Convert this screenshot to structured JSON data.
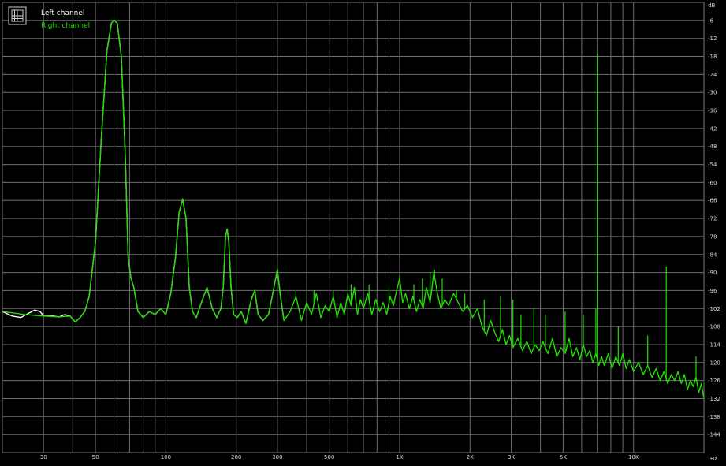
{
  "chart_data": {
    "type": "line",
    "x_scale": "log",
    "xlim": [
      20,
      20000
    ],
    "ylim": [
      -150,
      0
    ],
    "x_unit": "Hz",
    "y_unit": "dB",
    "grid": true,
    "legend_position": "top-left",
    "x_ticks": [
      {
        "value": 30,
        "label": "30"
      },
      {
        "value": 50,
        "label": "50"
      },
      {
        "value": 100,
        "label": "100"
      },
      {
        "value": 200,
        "label": "200"
      },
      {
        "value": 300,
        "label": "300"
      },
      {
        "value": 500,
        "label": "500"
      },
      {
        "value": 1000,
        "label": "1K"
      },
      {
        "value": 2000,
        "label": "2K"
      },
      {
        "value": 3000,
        "label": "3K"
      },
      {
        "value": 5000,
        "label": "5K"
      },
      {
        "value": 10000,
        "label": "10K"
      }
    ],
    "y_ticks": [
      {
        "value": -6,
        "label": "-6"
      },
      {
        "value": -12,
        "label": "-12"
      },
      {
        "value": -18,
        "label": "-18"
      },
      {
        "value": -24,
        "label": "-24"
      },
      {
        "value": -30,
        "label": "-30"
      },
      {
        "value": -36,
        "label": "-36"
      },
      {
        "value": -42,
        "label": "-42"
      },
      {
        "value": -48,
        "label": "-48"
      },
      {
        "value": -54,
        "label": "-54"
      },
      {
        "value": -60,
        "label": "-60"
      },
      {
        "value": -66,
        "label": "-66"
      },
      {
        "value": -72,
        "label": "-72"
      },
      {
        "value": -78,
        "label": "-78"
      },
      {
        "value": -84,
        "label": "-84"
      },
      {
        "value": -90,
        "label": "-90"
      },
      {
        "value": -96,
        "label": "-96"
      },
      {
        "value": -102,
        "label": "-102"
      },
      {
        "value": -108,
        "label": "-108"
      },
      {
        "value": -114,
        "label": "-114"
      },
      {
        "value": -120,
        "label": "-120"
      },
      {
        "value": -126,
        "label": "-126"
      },
      {
        "value": -132,
        "label": "-132"
      },
      {
        "value": -138,
        "label": "-138"
      },
      {
        "value": -144,
        "label": "-144"
      }
    ],
    "series": [
      {
        "name": "Left channel",
        "color": "#ffffff",
        "points": [
          [
            20,
            -103
          ],
          [
            22,
            -104.5
          ],
          [
            24,
            -105
          ],
          [
            26,
            -103.5
          ],
          [
            27.5,
            -102.5
          ],
          [
            29,
            -103
          ],
          [
            30,
            -104.5
          ],
          [
            33,
            -104.5
          ],
          [
            35,
            -104.8
          ],
          [
            37,
            -104
          ],
          [
            39,
            -104.5
          ],
          [
            41,
            -106.5
          ],
          [
            43,
            -105
          ],
          [
            45,
            -103
          ],
          [
            47,
            -98
          ],
          [
            50,
            -80
          ],
          [
            53,
            -45
          ],
          [
            56,
            -16
          ],
          [
            58.5,
            -7
          ],
          [
            60,
            -5.8
          ],
          [
            62,
            -7
          ],
          [
            64.5,
            -18
          ],
          [
            67,
            -50
          ],
          [
            69,
            -85
          ],
          [
            71,
            -92
          ],
          [
            73,
            -95
          ],
          [
            76,
            -103
          ],
          [
            80,
            -105
          ],
          [
            85,
            -103
          ],
          [
            90,
            -104
          ],
          [
            95,
            -102
          ],
          [
            100,
            -104
          ],
          [
            105,
            -97
          ],
          [
            110,
            -85
          ],
          [
            114,
            -70
          ],
          [
            118,
            -65.5
          ],
          [
            122,
            -72
          ],
          [
            126,
            -95
          ],
          [
            130,
            -103
          ],
          [
            135,
            -105
          ],
          [
            142,
            -100
          ],
          [
            150,
            -95
          ],
          [
            158,
            -102
          ],
          [
            165,
            -105
          ],
          [
            172,
            -102
          ],
          [
            176,
            -95
          ],
          [
            180,
            -78
          ],
          [
            183,
            -75.5
          ],
          [
            186,
            -80
          ],
          [
            190,
            -95
          ],
          [
            195,
            -104
          ],
          [
            202,
            -105
          ],
          [
            210,
            -103
          ],
          [
            220,
            -107
          ],
          [
            232,
            -99
          ],
          [
            240,
            -96
          ],
          [
            248,
            -104
          ],
          [
            260,
            -106
          ],
          [
            275,
            -104
          ],
          [
            290,
            -95
          ],
          [
            300,
            -89
          ],
          [
            308,
            -97
          ],
          [
            320,
            -106
          ]
        ]
      },
      {
        "name": "Right channel",
        "color": "#22dd00",
        "points": [
          [
            20,
            -103
          ],
          [
            25,
            -104
          ],
          [
            30,
            -104.5
          ],
          [
            35,
            -104.8
          ],
          [
            39,
            -104.5
          ],
          [
            41,
            -106.5
          ],
          [
            43,
            -105
          ],
          [
            45,
            -103
          ],
          [
            47,
            -98
          ],
          [
            50,
            -80
          ],
          [
            53,
            -45
          ],
          [
            56,
            -16
          ],
          [
            58.5,
            -7
          ],
          [
            60,
            -5.8
          ],
          [
            62,
            -7
          ],
          [
            64.5,
            -18
          ],
          [
            67,
            -50
          ],
          [
            69,
            -85
          ],
          [
            71,
            -92
          ],
          [
            73,
            -95
          ],
          [
            76,
            -103
          ],
          [
            80,
            -105
          ],
          [
            85,
            -103
          ],
          [
            90,
            -104
          ],
          [
            95,
            -102
          ],
          [
            100,
            -104
          ],
          [
            105,
            -97
          ],
          [
            110,
            -85
          ],
          [
            114,
            -70
          ],
          [
            118,
            -65.5
          ],
          [
            122,
            -72
          ],
          [
            126,
            -95
          ],
          [
            130,
            -103
          ],
          [
            135,
            -105
          ],
          [
            142,
            -100
          ],
          [
            150,
            -95
          ],
          [
            158,
            -102
          ],
          [
            165,
            -105
          ],
          [
            172,
            -102
          ],
          [
            176,
            -95
          ],
          [
            180,
            -78
          ],
          [
            183,
            -75.5
          ],
          [
            186,
            -80
          ],
          [
            190,
            -95
          ],
          [
            195,
            -104
          ],
          [
            202,
            -105
          ],
          [
            210,
            -103
          ],
          [
            220,
            -107
          ],
          [
            232,
            -99
          ],
          [
            240,
            -96
          ],
          [
            248,
            -104
          ],
          [
            260,
            -106
          ],
          [
            275,
            -104
          ],
          [
            290,
            -95
          ],
          [
            300,
            -89
          ],
          [
            308,
            -97
          ],
          [
            320,
            -106
          ],
          [
            340,
            -103
          ],
          [
            360,
            -98
          ],
          [
            380,
            -106
          ],
          [
            400,
            -100
          ],
          [
            420,
            -104
          ],
          [
            440,
            -97
          ],
          [
            460,
            -105
          ],
          [
            480,
            -101
          ],
          [
            500,
            -103
          ],
          [
            520,
            -98
          ],
          [
            540,
            -105
          ],
          [
            560,
            -100
          ],
          [
            580,
            -104
          ],
          [
            600,
            -97
          ],
          [
            620,
            -101
          ],
          [
            640,
            -95
          ],
          [
            660,
            -104
          ],
          [
            680,
            -99
          ],
          [
            700,
            -102
          ],
          [
            730,
            -97
          ],
          [
            760,
            -104
          ],
          [
            790,
            -99
          ],
          [
            820,
            -103
          ],
          [
            850,
            -100
          ],
          [
            880,
            -104
          ],
          [
            910,
            -98
          ],
          [
            940,
            -101
          ],
          [
            970,
            -96
          ],
          [
            1000,
            -92
          ],
          [
            1030,
            -100
          ],
          [
            1060,
            -97
          ],
          [
            1100,
            -102
          ],
          [
            1140,
            -98
          ],
          [
            1180,
            -103
          ],
          [
            1220,
            -99
          ],
          [
            1260,
            -102
          ],
          [
            1300,
            -95
          ],
          [
            1350,
            -100
          ],
          [
            1400,
            -90
          ],
          [
            1450,
            -97
          ],
          [
            1500,
            -102
          ],
          [
            1560,
            -99
          ],
          [
            1620,
            -101
          ],
          [
            1700,
            -97
          ],
          [
            1780,
            -100
          ],
          [
            1860,
            -103
          ],
          [
            1950,
            -101
          ],
          [
            2050,
            -105
          ],
          [
            2150,
            -102
          ],
          [
            2250,
            -108
          ],
          [
            2350,
            -111
          ],
          [
            2450,
            -106
          ],
          [
            2550,
            -110
          ],
          [
            2650,
            -113
          ],
          [
            2750,
            -109
          ],
          [
            2850,
            -114
          ],
          [
            2950,
            -111
          ],
          [
            3050,
            -115
          ],
          [
            3200,
            -112
          ],
          [
            3350,
            -116
          ],
          [
            3500,
            -113
          ],
          [
            3650,
            -117
          ],
          [
            3800,
            -114
          ],
          [
            3950,
            -116
          ],
          [
            4100,
            -113
          ],
          [
            4300,
            -117
          ],
          [
            4500,
            -112
          ],
          [
            4700,
            -118
          ],
          [
            4900,
            -115
          ],
          [
            5100,
            -117
          ],
          [
            5300,
            -112
          ],
          [
            5500,
            -118
          ],
          [
            5700,
            -115
          ],
          [
            5900,
            -119
          ],
          [
            6100,
            -114
          ],
          [
            6300,
            -118
          ],
          [
            6500,
            -116
          ],
          [
            6700,
            -120
          ],
          [
            6900,
            -117
          ],
          [
            7100,
            -121
          ],
          [
            7300,
            -118
          ],
          [
            7500,
            -121
          ],
          [
            7800,
            -117
          ],
          [
            8100,
            -122
          ],
          [
            8400,
            -118
          ],
          [
            8700,
            -121
          ],
          [
            9000,
            -117
          ],
          [
            9300,
            -122
          ],
          [
            9600,
            -119
          ],
          [
            10000,
            -123
          ],
          [
            10500,
            -120
          ],
          [
            11000,
            -124
          ],
          [
            11500,
            -121
          ],
          [
            12000,
            -125
          ],
          [
            12500,
            -122
          ],
          [
            13000,
            -126
          ],
          [
            13500,
            -123
          ],
          [
            14000,
            -127
          ],
          [
            14500,
            -124
          ],
          [
            15000,
            -126
          ],
          [
            15500,
            -123
          ],
          [
            16000,
            -127
          ],
          [
            16500,
            -124
          ],
          [
            17000,
            -129
          ],
          [
            17500,
            -126
          ],
          [
            18000,
            -128
          ],
          [
            18500,
            -125
          ],
          [
            19000,
            -130
          ],
          [
            19500,
            -127
          ],
          [
            20000,
            -132
          ]
        ]
      }
    ],
    "spikes": [
      {
        "f": 360,
        "db": -96
      },
      {
        "f": 430,
        "db": -96
      },
      {
        "f": 520,
        "db": -96
      },
      {
        "f": 620,
        "db": -94
      },
      {
        "f": 740,
        "db": -94
      },
      {
        "f": 900,
        "db": -95
      },
      {
        "f": 1000,
        "db": -91
      },
      {
        "f": 1150,
        "db": -94
      },
      {
        "f": 1250,
        "db": -92
      },
      {
        "f": 1350,
        "db": -90
      },
      {
        "f": 1410,
        "db": -89
      },
      {
        "f": 1520,
        "db": -92
      },
      {
        "f": 1750,
        "db": -96
      },
      {
        "f": 1900,
        "db": -97
      },
      {
        "f": 2300,
        "db": -99
      },
      {
        "f": 2700,
        "db": -98
      },
      {
        "f": 3050,
        "db": -99
      },
      {
        "f": 3300,
        "db": -104
      },
      {
        "f": 3750,
        "db": -102
      },
      {
        "f": 4200,
        "db": -104
      },
      {
        "f": 5100,
        "db": -103
      },
      {
        "f": 6100,
        "db": -104
      },
      {
        "f": 6900,
        "db": -102
      },
      {
        "f": 7000,
        "db": -17
      },
      {
        "f": 8600,
        "db": -108
      },
      {
        "f": 11500,
        "db": -111
      },
      {
        "f": 13800,
        "db": -88
      },
      {
        "f": 18500,
        "db": -118
      }
    ],
    "xlabel": "Hz",
    "ylabel": "dB"
  },
  "legend": {
    "items": [
      {
        "label": "Left channel",
        "color": "#ffffff"
      },
      {
        "label": "Right channel",
        "color": "#22dd00"
      }
    ]
  },
  "axis": {
    "x_unit": "Hz",
    "y_unit": "dB"
  }
}
